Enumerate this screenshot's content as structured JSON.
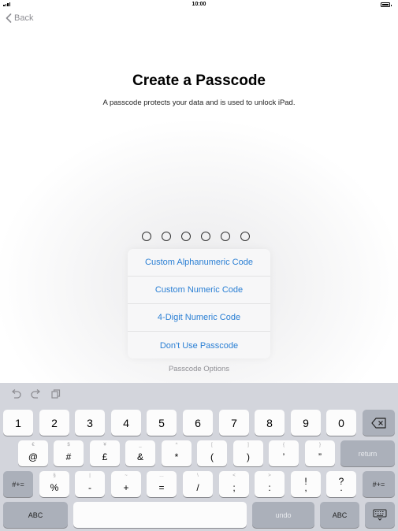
{
  "status_bar": {
    "time": "10:00"
  },
  "nav": {
    "back_label": "Back"
  },
  "header": {
    "title": "Create a Passcode",
    "subtitle": "A passcode protects your data and is used to unlock iPad."
  },
  "passcode": {
    "digit_count": 6,
    "entered_count": 0
  },
  "options_menu": {
    "items": [
      "Custom Alphanumeric Code",
      "Custom Numeric Code",
      "4-Digit Numeric Code",
      "Don't Use Passcode"
    ],
    "footer_label": "Passcode Options"
  },
  "keyboard": {
    "row1": [
      "1",
      "2",
      "3",
      "4",
      "5",
      "6",
      "7",
      "8",
      "9",
      "0"
    ],
    "row2": [
      {
        "main": "@",
        "sub": "€"
      },
      {
        "main": "#",
        "sub": "$"
      },
      {
        "main": "£",
        "sub": "¥"
      },
      {
        "main": "&",
        "sub": "_"
      },
      {
        "main": "*",
        "sub": "^"
      },
      {
        "main": "(",
        "sub": "["
      },
      {
        "main": ")",
        "sub": "]"
      },
      {
        "main": "’",
        "sub": "{"
      },
      {
        "main": "”",
        "sub": "}"
      }
    ],
    "return_label": "return",
    "row3": [
      {
        "main": "%",
        "sub": "§"
      },
      {
        "main": "-",
        "sub": "|"
      },
      {
        "main": "+",
        "sub": "~"
      },
      {
        "main": "=",
        "sub": "…"
      },
      {
        "main": "/",
        "sub": "\\"
      },
      {
        "main": ";",
        "sub": "<"
      },
      {
        "main": ":",
        "sub": ">"
      },
      {
        "main": "!",
        "sub": ""
      },
      {
        "main": "?",
        "sub": ""
      }
    ],
    "row3_plain": [
      "!",
      "?"
    ],
    "row3_plain_sub": [
      ",",
      "."
    ],
    "symbols_label": "#+=",
    "abc_label": "ABC",
    "undo_label": "undo",
    "accent_color": "#2a7fd4"
  }
}
